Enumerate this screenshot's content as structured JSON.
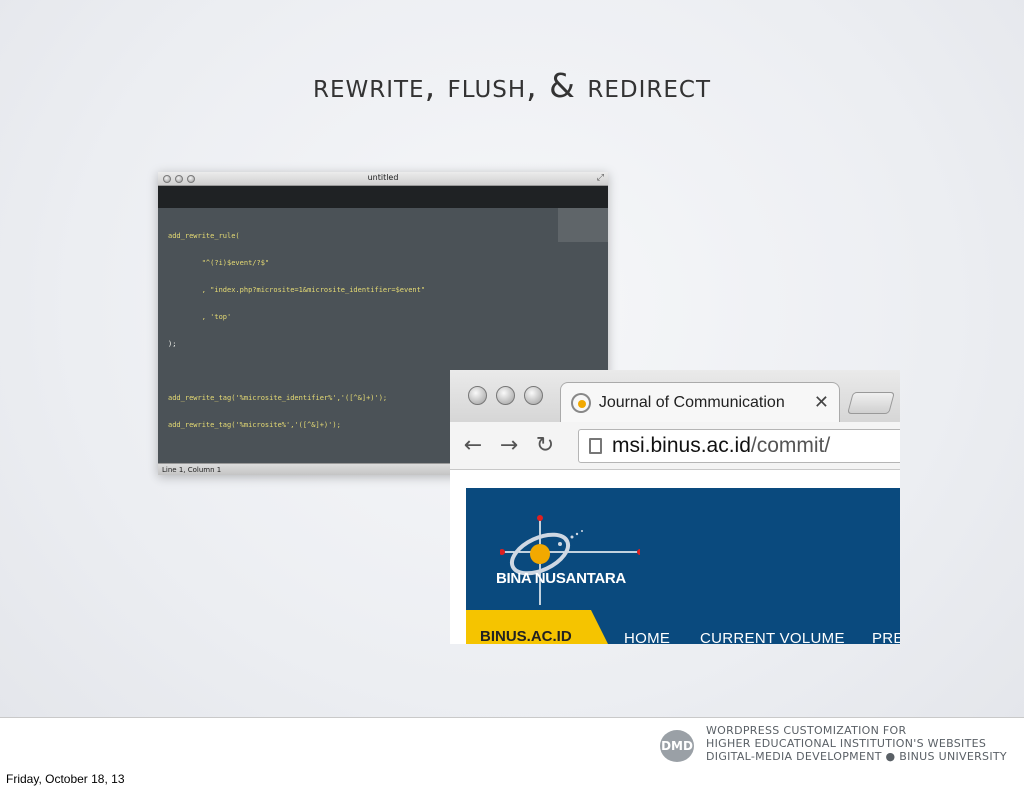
{
  "slide": {
    "title": "Rewrite, Flush, & Redirect"
  },
  "editor": {
    "window_title": "untitled",
    "code_lines": [
      "add_rewrite_rule(",
      "        \"^(?i)$event/?$\"",
      "        , \"index.php?microsite=1&microsite_identifier=$event\"",
      "        , 'top'",
      ");",
      "",
      "add_rewrite_tag('%microsite_identifier%','([^&]+)');",
      "add_rewrite_tag('%microsite%','([^&]+)');"
    ],
    "status": "Line 1, Column 1"
  },
  "browser": {
    "tab_title": "Journal of Communication",
    "tab_close": "✕",
    "url_host": "msi.binus.ac.id",
    "url_path": "/commit/",
    "back": "←",
    "forward": "→",
    "reload": "↻",
    "site": {
      "logo_text": "BINA NUSANTARA",
      "nav_brand": "BINUS.AC.ID",
      "nav_items": [
        "HOME",
        "CURRENT VOLUME",
        "PRE"
      ]
    }
  },
  "footer": {
    "logo": "DMD",
    "lines": [
      "WordPress Customization for",
      "Higher Educational Institution's Websites",
      "Digital-Media Development ● BINUS UNIVERSITY"
    ]
  },
  "date_label": "Friday, October 18, 13",
  "colors": {
    "site_blue": "#0a4a7e",
    "site_yellow": "#f5c400",
    "editor_bg": "#4b5257"
  }
}
